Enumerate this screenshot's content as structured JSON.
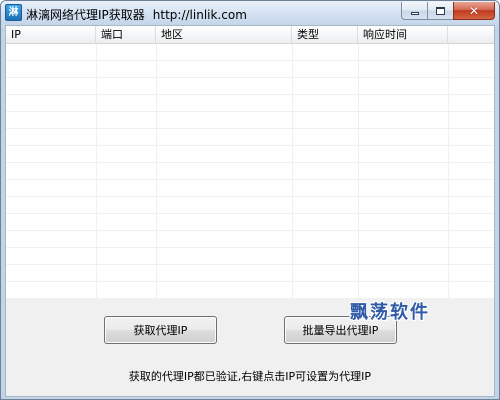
{
  "window": {
    "icon_text": "淋",
    "title": "淋漓网络代理IP获取器",
    "url": "http://linlik.com"
  },
  "proxy_list": {
    "columns": [
      "IP",
      "端口",
      "地区",
      "类型",
      "响应时间"
    ],
    "rows": []
  },
  "buttons": {
    "fetch_label": "获取代理IP",
    "export_label": "批量导出代理IP"
  },
  "status": {
    "text": "获取的代理IP都已验证,右键点击IP可设置为代理IP"
  },
  "watermark": {
    "text": "飘荡软件"
  },
  "icons": {
    "app": "app-icon",
    "minimize": "minimize-icon",
    "maximize": "maximize-icon",
    "close": "close-icon"
  }
}
